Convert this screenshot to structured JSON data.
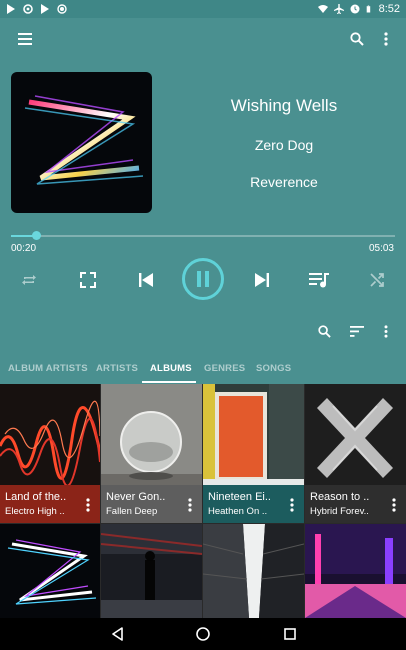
{
  "status_bar": {
    "time": "8:52",
    "notification_icons": [
      "play-store-icon",
      "sync-icon",
      "play-store-icon",
      "record-icon"
    ],
    "system_icons": [
      "wifi-icon",
      "airplane-icon",
      "alarm-icon",
      "battery-icon"
    ]
  },
  "toolbar": {
    "menu_icon": "hamburger-menu-icon",
    "search_icon": "search-icon",
    "overflow_icon": "more-vert-icon"
  },
  "now_playing": {
    "title": "Wishing Wells",
    "artist": "Zero Dog",
    "album": "Reverence",
    "elapsed": "00:20",
    "duration": "05:03",
    "progress": 0.066
  },
  "controls": [
    "repeat-icon",
    "fullscreen-icon",
    "skip-previous-icon",
    "pause-icon",
    "skip-next-icon",
    "queue-music-icon",
    "shuffle-icon"
  ],
  "library_toolbar": [
    "search-icon",
    "sort-icon",
    "more-vert-icon"
  ],
  "tabs": [
    {
      "label": "ALBUM ARTISTS",
      "active": false
    },
    {
      "label": "ARTISTS",
      "active": false
    },
    {
      "label": "ALBUMS",
      "active": true
    },
    {
      "label": "GENRES",
      "active": false
    },
    {
      "label": "SONGS",
      "active": false
    }
  ],
  "albums": [
    {
      "title": "Land of the..",
      "artist": "Electro High ..",
      "caption_color": "#8b2418"
    },
    {
      "title": "Never Gon..",
      "artist": "Fallen Deep",
      "caption_color": "#5e5e5e"
    },
    {
      "title": "Nineteen Ei..",
      "artist": "Heathen On ..",
      "caption_color": "#1c5c5e"
    },
    {
      "title": "Reason to ..",
      "artist": "Hybrid Forev..",
      "caption_color": "#2e2e2e"
    }
  ],
  "colors": {
    "background": "#4a9090",
    "accent": "#5fd2d8"
  },
  "nav": [
    "back-icon",
    "home-icon",
    "recents-icon"
  ]
}
